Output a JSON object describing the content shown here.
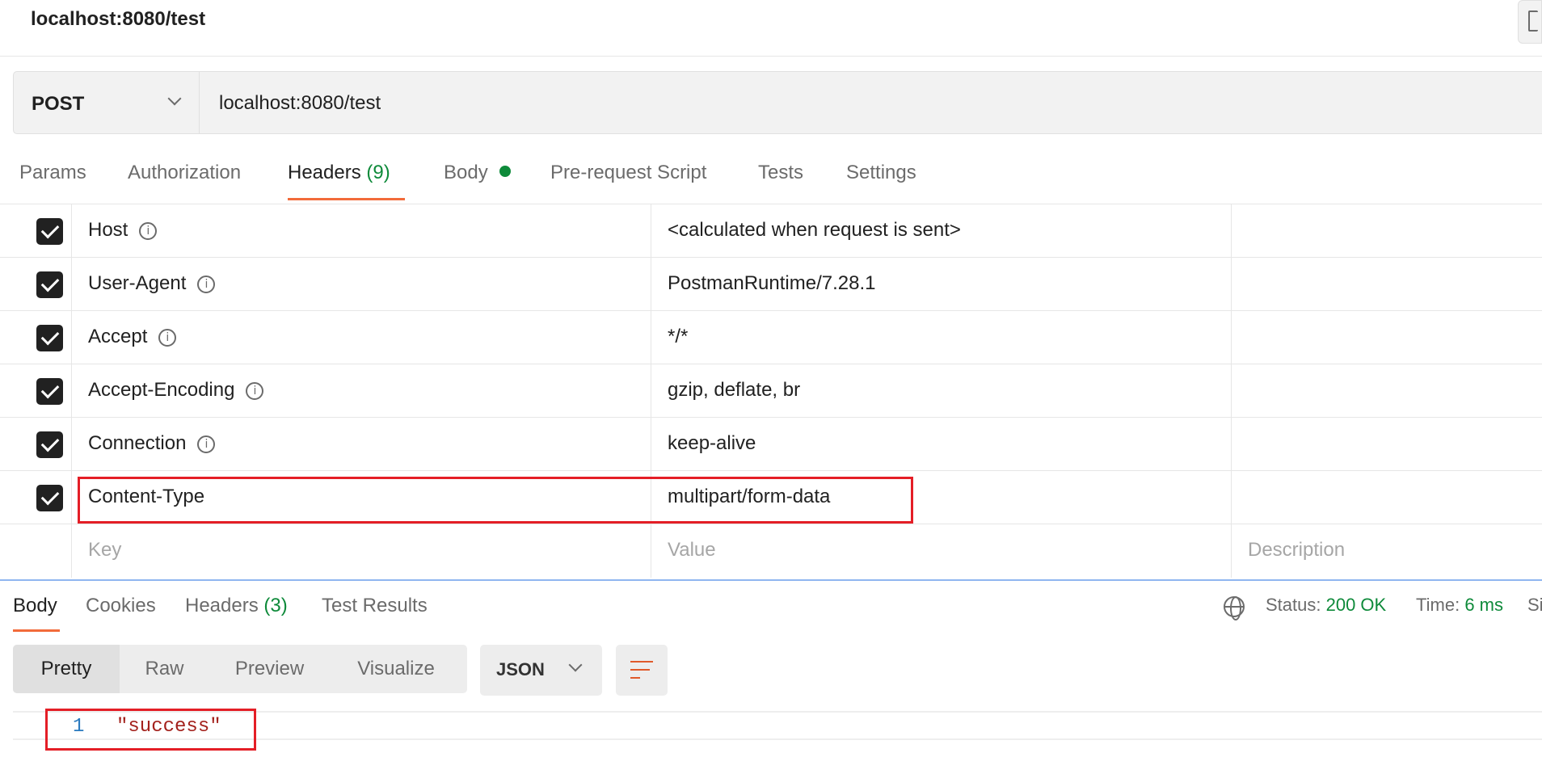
{
  "request_title": "localhost:8080/test",
  "request": {
    "method": "POST",
    "url": "localhost:8080/test"
  },
  "request_tabs": {
    "params": "Params",
    "authorization": "Authorization",
    "headers": "Headers",
    "headers_count": "(9)",
    "body": "Body",
    "pre_request_script": "Pre-request Script",
    "tests": "Tests",
    "settings": "Settings"
  },
  "headers": [
    {
      "key": "Host",
      "value": "<calculated when request is sent>",
      "checked": true
    },
    {
      "key": "User-Agent",
      "value": "PostmanRuntime/7.28.1",
      "checked": true
    },
    {
      "key": "Accept",
      "value": "*/*",
      "checked": true
    },
    {
      "key": "Accept-Encoding",
      "value": "gzip, deflate, br",
      "checked": true
    },
    {
      "key": "Connection",
      "value": "keep-alive",
      "checked": true
    },
    {
      "key": "Content-Type",
      "value": "multipart/form-data",
      "checked": true
    }
  ],
  "new_header_placeholders": {
    "key": "Key",
    "value": "Value",
    "description": "Description"
  },
  "response_tabs": {
    "body": "Body",
    "cookies": "Cookies",
    "headers": "Headers",
    "headers_count": "(3)",
    "test_results": "Test Results"
  },
  "response_status": {
    "status_label": "Status:",
    "status_value": "200 OK",
    "time_label": "Time:",
    "time_value": "6 ms",
    "size_label_partial": "Si"
  },
  "body_views": {
    "pretty": "Pretty",
    "raw": "Raw",
    "preview": "Preview",
    "visualize": "Visualize"
  },
  "format": "JSON",
  "response_body": {
    "line_number": "1",
    "text": "\"success\""
  },
  "colors": {
    "accent_orange": "#f26b3a",
    "success_green": "#0e8a3a",
    "highlight_red": "#e41e26",
    "string_red": "#a3211c",
    "line_number_blue": "#2a7abf"
  },
  "icons": {
    "method_dropdown": "chevron-down-icon",
    "header_info": "info-icon",
    "network": "globe-icon",
    "wrap": "wrap-lines-icon",
    "format_dropdown": "chevron-down-icon"
  }
}
